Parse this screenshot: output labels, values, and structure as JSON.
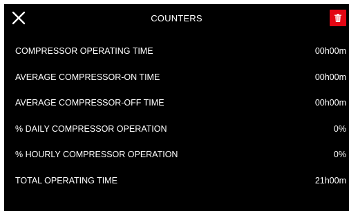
{
  "header": {
    "title": "COUNTERS",
    "close_icon": "close-icon",
    "delete_icon": "trash-icon",
    "delete_color": "#e30613"
  },
  "counters": [
    {
      "label": "COMPRESSOR OPERATING TIME",
      "value": "00h00m"
    },
    {
      "label": "AVERAGE COMPRESSOR-ON TIME",
      "value": "00h00m"
    },
    {
      "label": "AVERAGE COMPRESSOR-OFF TIME",
      "value": "00h00m"
    },
    {
      "label": "% DAILY COMPRESSOR OPERATION",
      "value": "0%"
    },
    {
      "label": "% HOURLY COMPRESSOR OPERATION",
      "value": "0%"
    },
    {
      "label": "TOTAL OPERATING TIME",
      "value": "21h00m"
    }
  ]
}
